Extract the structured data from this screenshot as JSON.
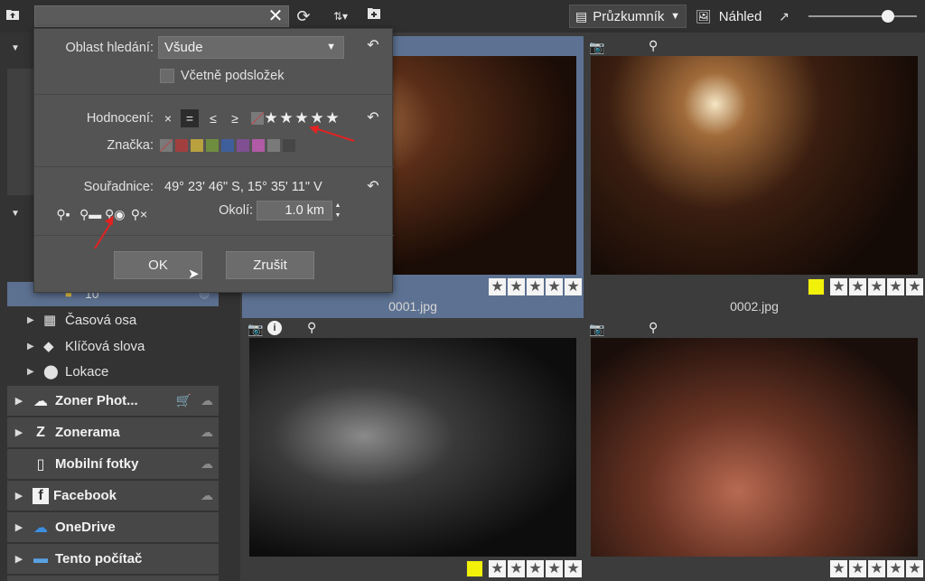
{
  "toolbar": {
    "search_value": "",
    "mode_label": "Průzkumník",
    "preview_label": "Náhled"
  },
  "dialog": {
    "area_label": "Oblast hledání:",
    "area_value": "Všude",
    "subfolders_label": "Včetně podsložek",
    "rating_label": "Hodnocení:",
    "rating_ops": [
      "×",
      "=",
      "≤",
      "≥"
    ],
    "rating_selected_op": "=",
    "rating_stars": 5,
    "tag_label": "Značka:",
    "tag_colors": [
      "#a13f3f",
      "#b9a13e",
      "#6f8d3e",
      "#3f5f9c",
      "#7f4f92",
      "#b15aa5",
      "#7a7a7a",
      "#464646"
    ],
    "coords_label": "Souřadnice:",
    "coords_value": "49° 23' 46\" S, 15° 35' 11\" V",
    "radius_label": "Okolí:",
    "radius_value": "1.0 km",
    "ok_label": "OK",
    "cancel_label": "Zrušit"
  },
  "sidebar": {
    "tree": [
      {
        "label": "Časová osa",
        "icon": "calendar-icon"
      },
      {
        "label": "Klíčová slova",
        "icon": "tag-icon"
      },
      {
        "label": "Lokace",
        "icon": "location-pin-icon"
      }
    ],
    "partial_item": "10",
    "services": [
      {
        "label": "Zoner Phot...",
        "icon": "cloud-icon"
      },
      {
        "label": "Zonerama",
        "icon": "zonerama-icon"
      },
      {
        "label": "Mobilní fotky",
        "icon": "phone-icon"
      },
      {
        "label": "Facebook",
        "icon": "facebook-icon"
      },
      {
        "label": "OneDrive",
        "icon": "onedrive-icon"
      },
      {
        "label": "Tento počítač",
        "icon": "computer-icon"
      }
    ]
  },
  "photos": [
    {
      "filename": "0001.jpg",
      "rating": 5,
      "label_color": "",
      "selected": true
    },
    {
      "filename": "0002.jpg",
      "rating": 5,
      "label_color": "#f1f10a",
      "selected": false
    },
    {
      "filename": "",
      "rating": 5,
      "label_color": "#f1f10a",
      "selected": false
    },
    {
      "filename": "",
      "rating": 5,
      "label_color": "",
      "selected": false
    }
  ]
}
